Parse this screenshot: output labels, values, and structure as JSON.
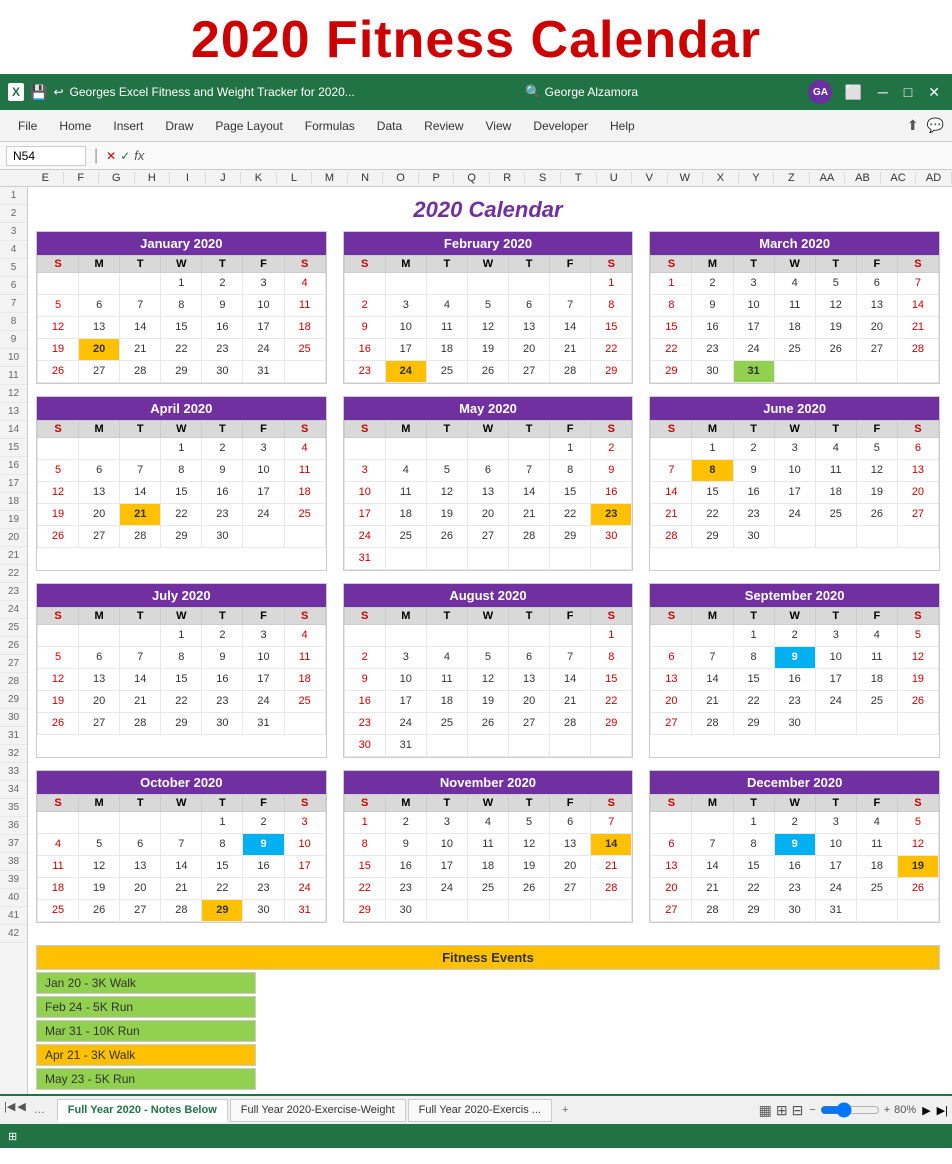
{
  "title": "2020 Fitness Calendar",
  "excel": {
    "title_bar": "Georges Excel Fitness and Weight Tracker for 2020...",
    "user": "George Alzamora",
    "user_initials": "GA",
    "cell_ref": "N54",
    "ribbon_tabs": [
      "File",
      "Home",
      "Insert",
      "Draw",
      "Page Layout",
      "Formulas",
      "Data",
      "Review",
      "View",
      "Developer",
      "Help"
    ],
    "col_headers": [
      "E",
      "F",
      "G",
      "H",
      "I",
      "J",
      "K",
      "L",
      "M",
      "N",
      "O",
      "P",
      "Q",
      "R",
      "S",
      "T",
      "U",
      "V",
      "W",
      "X",
      "Y",
      "Z",
      "AA",
      "AB",
      "AC",
      "AD"
    ]
  },
  "calendar_title": "2020 Calendar",
  "months": [
    {
      "name": "January 2020",
      "days_header": [
        "S",
        "M",
        "T",
        "W",
        "T",
        "F",
        "S"
      ],
      "weeks": [
        [
          "",
          "",
          "",
          "1",
          "2",
          "3",
          "4"
        ],
        [
          "5",
          "6",
          "7",
          "8",
          "9",
          "10",
          "11"
        ],
        [
          "12",
          "13",
          "14",
          "15",
          "16",
          "17",
          "18"
        ],
        [
          "19",
          "20",
          "21",
          "22",
          "23",
          "24",
          "25"
        ],
        [
          "26",
          "27",
          "28",
          "29",
          "30",
          "31",
          ""
        ]
      ],
      "highlights": {
        "20": "orange"
      }
    },
    {
      "name": "February 2020",
      "days_header": [
        "S",
        "M",
        "T",
        "W",
        "T",
        "F",
        "S"
      ],
      "weeks": [
        [
          "",
          "",
          "",
          "",
          "",
          "",
          "1"
        ],
        [
          "2",
          "3",
          "4",
          "5",
          "6",
          "7",
          "8"
        ],
        [
          "9",
          "10",
          "11",
          "12",
          "13",
          "14",
          "15"
        ],
        [
          "16",
          "17",
          "18",
          "19",
          "20",
          "21",
          "22"
        ],
        [
          "23",
          "24",
          "25",
          "26",
          "27",
          "28",
          "29"
        ]
      ],
      "highlights": {
        "24": "orange"
      }
    },
    {
      "name": "March 2020",
      "days_header": [
        "S",
        "M",
        "T",
        "W",
        "T",
        "F",
        "S"
      ],
      "weeks": [
        [
          "1",
          "2",
          "3",
          "4",
          "5",
          "6",
          "7"
        ],
        [
          "8",
          "9",
          "10",
          "11",
          "12",
          "13",
          "14"
        ],
        [
          "15",
          "16",
          "17",
          "18",
          "19",
          "20",
          "21"
        ],
        [
          "22",
          "23",
          "24",
          "25",
          "26",
          "27",
          "28"
        ],
        [
          "29",
          "30",
          "31",
          "",
          "",
          "",
          ""
        ]
      ],
      "highlights": {
        "31": "green"
      }
    },
    {
      "name": "April 2020",
      "days_header": [
        "S",
        "M",
        "T",
        "W",
        "T",
        "F",
        "S"
      ],
      "weeks": [
        [
          "",
          "",
          "",
          "1",
          "2",
          "3",
          "4"
        ],
        [
          "5",
          "6",
          "7",
          "8",
          "9",
          "10",
          "11"
        ],
        [
          "12",
          "13",
          "14",
          "15",
          "16",
          "17",
          "18"
        ],
        [
          "19",
          "20",
          "21",
          "22",
          "23",
          "24",
          "25"
        ],
        [
          "26",
          "27",
          "28",
          "29",
          "30",
          "",
          ""
        ]
      ],
      "highlights": {
        "21": "orange"
      }
    },
    {
      "name": "May 2020",
      "days_header": [
        "S",
        "M",
        "T",
        "W",
        "T",
        "F",
        "S"
      ],
      "weeks": [
        [
          "",
          "",
          "",
          "",
          "",
          "1",
          "2"
        ],
        [
          "3",
          "4",
          "5",
          "6",
          "7",
          "8",
          "9"
        ],
        [
          "10",
          "11",
          "12",
          "13",
          "14",
          "15",
          "16"
        ],
        [
          "17",
          "18",
          "19",
          "20",
          "21",
          "22",
          "23"
        ],
        [
          "24",
          "25",
          "26",
          "27",
          "28",
          "29",
          "30"
        ],
        [
          "31",
          "",
          "",
          "",
          "",
          "",
          ""
        ]
      ],
      "highlights": {
        "23": "orange"
      }
    },
    {
      "name": "June 2020",
      "days_header": [
        "S",
        "M",
        "T",
        "W",
        "T",
        "F",
        "S"
      ],
      "weeks": [
        [
          "",
          "1",
          "2",
          "3",
          "4",
          "5",
          "6"
        ],
        [
          "7",
          "8",
          "9",
          "10",
          "11",
          "12",
          "13"
        ],
        [
          "14",
          "15",
          "16",
          "17",
          "18",
          "19",
          "20"
        ],
        [
          "21",
          "22",
          "23",
          "24",
          "25",
          "26",
          "27"
        ],
        [
          "28",
          "29",
          "30",
          "",
          "",
          "",
          ""
        ]
      ],
      "highlights": {
        "8": "orange"
      }
    },
    {
      "name": "July 2020",
      "days_header": [
        "S",
        "M",
        "T",
        "W",
        "T",
        "F",
        "S"
      ],
      "weeks": [
        [
          "",
          "",
          "",
          "1",
          "2",
          "3",
          "4"
        ],
        [
          "5",
          "6",
          "7",
          "8",
          "9",
          "10",
          "11"
        ],
        [
          "12",
          "13",
          "14",
          "15",
          "16",
          "17",
          "18"
        ],
        [
          "19",
          "20",
          "21",
          "22",
          "23",
          "24",
          "25"
        ],
        [
          "26",
          "27",
          "28",
          "29",
          "30",
          "31",
          ""
        ]
      ],
      "highlights": {}
    },
    {
      "name": "August 2020",
      "days_header": [
        "S",
        "M",
        "T",
        "W",
        "T",
        "F",
        "S"
      ],
      "weeks": [
        [
          "",
          "",
          "",
          "",
          "",
          "",
          "1"
        ],
        [
          "2",
          "3",
          "4",
          "5",
          "6",
          "7",
          "8"
        ],
        [
          "9",
          "10",
          "11",
          "12",
          "13",
          "14",
          "15"
        ],
        [
          "16",
          "17",
          "18",
          "19",
          "20",
          "21",
          "22"
        ],
        [
          "23",
          "24",
          "25",
          "26",
          "27",
          "28",
          "29"
        ],
        [
          "30",
          "31",
          "",
          "",
          "",
          "",
          ""
        ]
      ],
      "highlights": {}
    },
    {
      "name": "September 2020",
      "days_header": [
        "S",
        "M",
        "T",
        "W",
        "T",
        "F",
        "S"
      ],
      "weeks": [
        [
          "",
          "",
          "1",
          "2",
          "3",
          "4",
          "5"
        ],
        [
          "6",
          "7",
          "8",
          "9",
          "10",
          "11",
          "12"
        ],
        [
          "13",
          "14",
          "15",
          "16",
          "17",
          "18",
          "19"
        ],
        [
          "20",
          "21",
          "22",
          "23",
          "24",
          "25",
          "26"
        ],
        [
          "27",
          "28",
          "29",
          "30",
          "",
          "",
          ""
        ]
      ],
      "highlights": {
        "9": "blue"
      }
    },
    {
      "name": "October 2020",
      "days_header": [
        "S",
        "M",
        "T",
        "W",
        "T",
        "F",
        "S"
      ],
      "weeks": [
        [
          "",
          "",
          "",
          "",
          "1",
          "2",
          "3"
        ],
        [
          "4",
          "5",
          "6",
          "7",
          "8",
          "9",
          "10"
        ],
        [
          "11",
          "12",
          "13",
          "14",
          "15",
          "16",
          "17"
        ],
        [
          "18",
          "19",
          "20",
          "21",
          "22",
          "23",
          "24"
        ],
        [
          "25",
          "26",
          "27",
          "28",
          "29",
          "30",
          "31"
        ]
      ],
      "highlights": {
        "9": "blue",
        "29": "orange"
      }
    },
    {
      "name": "November 2020",
      "days_header": [
        "S",
        "M",
        "T",
        "W",
        "T",
        "F",
        "S"
      ],
      "weeks": [
        [
          "1",
          "2",
          "3",
          "4",
          "5",
          "6",
          "7"
        ],
        [
          "8",
          "9",
          "10",
          "11",
          "12",
          "13",
          "14"
        ],
        [
          "15",
          "16",
          "17",
          "18",
          "19",
          "20",
          "21"
        ],
        [
          "22",
          "23",
          "24",
          "25",
          "26",
          "27",
          "28"
        ],
        [
          "29",
          "30",
          "",
          "",
          "",
          "",
          ""
        ]
      ],
      "highlights": {
        "14": "orange"
      }
    },
    {
      "name": "December 2020",
      "days_header": [
        "S",
        "M",
        "T",
        "W",
        "T",
        "F",
        "S"
      ],
      "weeks": [
        [
          "",
          "",
          "1",
          "2",
          "3",
          "4",
          "5"
        ],
        [
          "6",
          "7",
          "8",
          "9",
          "10",
          "11",
          "12"
        ],
        [
          "13",
          "14",
          "15",
          "16",
          "17",
          "18",
          "19"
        ],
        [
          "20",
          "21",
          "22",
          "23",
          "24",
          "25",
          "26"
        ],
        [
          "27",
          "28",
          "29",
          "30",
          "31",
          "",
          ""
        ]
      ],
      "highlights": {
        "9": "blue",
        "19": "orange"
      }
    }
  ],
  "fitness_section": {
    "header": "Fitness Events",
    "events": [
      {
        "label": "Jan 20 - 3K Walk",
        "color": "green"
      },
      {
        "label": "Feb 24 - 5K Run",
        "color": "green"
      },
      {
        "label": "Mar 31 - 10K Run",
        "color": "green"
      },
      {
        "label": "Apr 21 - 3K Walk",
        "color": "orange"
      },
      {
        "label": "May 23 - 5K Run",
        "color": "green"
      }
    ]
  },
  "tabs": [
    {
      "label": "Full Year 2020 - Notes Below",
      "active": true
    },
    {
      "label": "Full Year 2020-Exercise-Weight",
      "active": false
    },
    {
      "label": "Full Year 2020-Exercis ...",
      "active": false
    }
  ],
  "status_bar": {
    "zoom": "80%"
  }
}
